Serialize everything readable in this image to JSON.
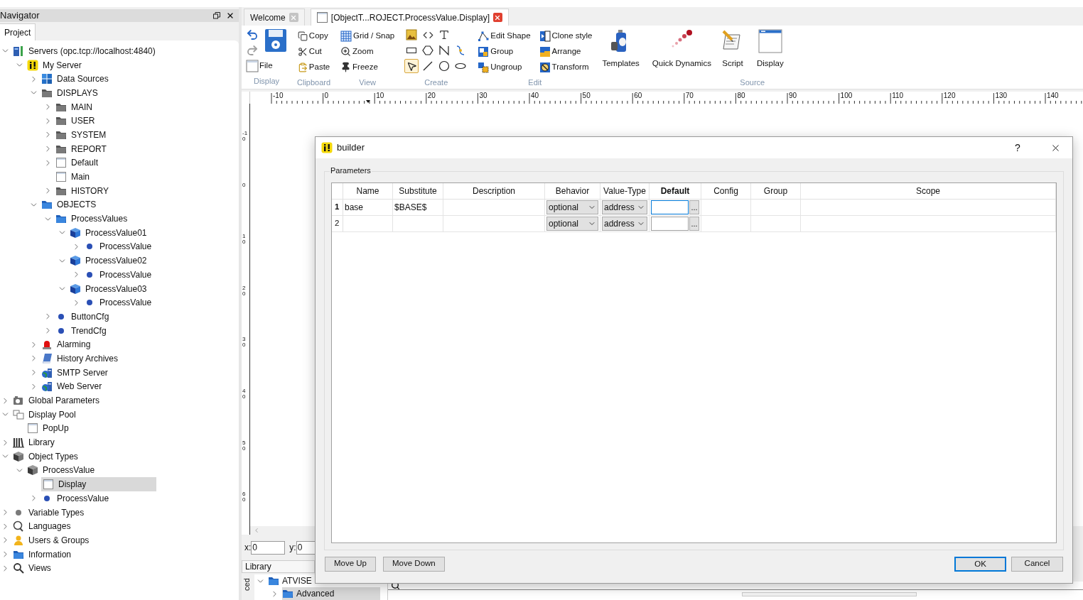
{
  "navigator": {
    "title": "Navigator",
    "tabs": [
      {
        "label": "Project",
        "selected": true
      }
    ],
    "tree": [
      {
        "label": "Servers (opc.tcp://localhost:4840)",
        "kind": "server",
        "leaf": false,
        "expanded": true,
        "selected": false,
        "children": [
          {
            "label": "My Server",
            "kind": "app",
            "leaf": false,
            "expanded": true,
            "selected": false,
            "children": [
              {
                "label": "Data Sources",
                "kind": "tiles",
                "leaf": false,
                "expanded": false,
                "selected": false
              },
              {
                "label": "DISPLAYS",
                "kind": "folder-gray",
                "leaf": false,
                "expanded": true,
                "selected": false,
                "children": [
                  {
                    "label": "MAIN",
                    "kind": "folder-gray",
                    "leaf": false,
                    "expanded": false,
                    "selected": false
                  },
                  {
                    "label": "USER",
                    "kind": "folder-gray",
                    "leaf": false,
                    "expanded": false,
                    "selected": false
                  },
                  {
                    "label": "SYSTEM",
                    "kind": "folder-gray",
                    "leaf": false,
                    "expanded": false,
                    "selected": false
                  },
                  {
                    "label": "REPORT",
                    "kind": "folder-gray",
                    "leaf": false,
                    "expanded": false,
                    "selected": false
                  },
                  {
                    "label": "Default",
                    "kind": "window",
                    "leaf": false,
                    "expanded": false,
                    "selected": false
                  },
                  {
                    "label": "Main",
                    "kind": "window",
                    "leaf": true,
                    "selected": false
                  },
                  {
                    "label": "HISTORY",
                    "kind": "folder-gray",
                    "leaf": false,
                    "expanded": false,
                    "selected": false
                  }
                ]
              },
              {
                "label": "OBJECTS",
                "kind": "folder-blue",
                "leaf": false,
                "expanded": true,
                "selected": false,
                "children": [
                  {
                    "label": "ProcessValues",
                    "kind": "folder-blue",
                    "leaf": false,
                    "expanded": true,
                    "selected": false,
                    "children": [
                      {
                        "label": "ProcessValue01",
                        "kind": "cube-blue",
                        "leaf": false,
                        "expanded": true,
                        "selected": false,
                        "children": [
                          {
                            "label": "ProcessValue",
                            "kind": "dot-blue",
                            "leaf": false,
                            "expanded": false,
                            "selected": false
                          }
                        ]
                      },
                      {
                        "label": "ProcessValue02",
                        "kind": "cube-blue",
                        "leaf": false,
                        "expanded": true,
                        "selected": false,
                        "children": [
                          {
                            "label": "ProcessValue",
                            "kind": "dot-blue",
                            "leaf": false,
                            "expanded": false,
                            "selected": false
                          }
                        ]
                      },
                      {
                        "label": "ProcessValue03",
                        "kind": "cube-blue",
                        "leaf": false,
                        "expanded": true,
                        "selected": false,
                        "children": [
                          {
                            "label": "ProcessValue",
                            "kind": "dot-blue",
                            "leaf": false,
                            "expanded": false,
                            "selected": false
                          }
                        ]
                      }
                    ]
                  },
                  {
                    "label": "ButtonCfg",
                    "kind": "dot-blue",
                    "leaf": false,
                    "expanded": false,
                    "selected": false
                  },
                  {
                    "label": "TrendCfg",
                    "kind": "dot-blue",
                    "leaf": false,
                    "expanded": false,
                    "selected": false
                  }
                ]
              },
              {
                "label": "Alarming",
                "kind": "alarm",
                "leaf": false,
                "expanded": false,
                "selected": false
              },
              {
                "label": "History Archives",
                "kind": "book",
                "leaf": false,
                "expanded": false,
                "selected": false
              },
              {
                "label": "SMTP Server",
                "kind": "smtp",
                "leaf": false,
                "expanded": false,
                "selected": false
              },
              {
                "label": "Web Server",
                "kind": "web",
                "leaf": false,
                "expanded": false,
                "selected": false
              }
            ]
          }
        ]
      },
      {
        "label": "Global Parameters",
        "kind": "camera",
        "leaf": false,
        "expanded": false,
        "selected": false
      },
      {
        "label": "Display Pool",
        "kind": "pool",
        "leaf": false,
        "expanded": true,
        "selected": false,
        "children": [
          {
            "label": "PopUp",
            "kind": "window",
            "leaf": true,
            "selected": false
          }
        ]
      },
      {
        "label": "Library",
        "kind": "library",
        "leaf": false,
        "expanded": false,
        "selected": false
      },
      {
        "label": "Object Types",
        "kind": "cube-gray",
        "leaf": false,
        "expanded": true,
        "selected": false,
        "children": [
          {
            "label": "ProcessValue",
            "kind": "cube-gray",
            "leaf": false,
            "expanded": true,
            "selected": false,
            "children": [
              {
                "label": "Display",
                "kind": "window",
                "leaf": true,
                "selected": true
              },
              {
                "label": "ProcessValue",
                "kind": "dot-blue",
                "leaf": false,
                "expanded": false,
                "selected": false
              }
            ]
          }
        ]
      },
      {
        "label": "Variable Types",
        "kind": "dot-gray",
        "leaf": false,
        "expanded": false,
        "selected": false
      },
      {
        "label": "Languages",
        "kind": "languages",
        "leaf": false,
        "expanded": false,
        "selected": false
      },
      {
        "label": "Users & Groups",
        "kind": "user",
        "leaf": false,
        "expanded": false,
        "selected": false
      },
      {
        "label": "Information",
        "kind": "folder-blue",
        "leaf": false,
        "expanded": false,
        "selected": false
      },
      {
        "label": "Views",
        "kind": "search",
        "leaf": false,
        "expanded": false,
        "selected": false
      }
    ]
  },
  "document_tabs": [
    {
      "label": "Welcome",
      "selected": false
    },
    {
      "label": "[ObjectT...ROJECT.ProcessValue.Display]",
      "selected": true
    }
  ],
  "ribbon": {
    "groups": [
      {
        "kind": "display",
        "label": "Display",
        "items": [
          {
            "kind": "undo"
          },
          {
            "kind": "redo"
          },
          {
            "kind": "save"
          },
          {
            "kind": "file",
            "label": "File"
          }
        ]
      },
      {
        "kind": "list",
        "label": "Clipboard",
        "items": [
          {
            "kind": "copy",
            "label": "Copy"
          },
          {
            "kind": "cut",
            "label": "Cut"
          },
          {
            "kind": "paste",
            "label": "Paste"
          }
        ]
      },
      {
        "kind": "list",
        "label": "View",
        "items": [
          {
            "kind": "grid",
            "label": "Grid / Snap"
          },
          {
            "kind": "zoom",
            "label": "Zoom"
          },
          {
            "kind": "freeze",
            "label": "Freeze"
          }
        ]
      },
      {
        "kind": "tools",
        "label": "Create",
        "rows": [
          [
            {
              "kind": "image",
              "selected": false
            },
            {
              "kind": "code",
              "selected": false
            },
            {
              "kind": "text",
              "selected": false
            }
          ],
          [
            {
              "kind": "rect",
              "selected": false
            },
            {
              "kind": "hexagon",
              "selected": false
            },
            {
              "kind": "polyline",
              "selected": false
            },
            {
              "kind": "connector",
              "selected": false
            }
          ],
          [
            {
              "kind": "pointer",
              "selected": true
            },
            {
              "kind": "line",
              "selected": false
            },
            {
              "kind": "circle",
              "selected": false
            },
            {
              "kind": "ellipse",
              "selected": false
            }
          ]
        ]
      },
      {
        "kind": "list",
        "label": "Edit",
        "items": [
          {
            "kind": "edit-shape",
            "label": "Edit Shape"
          },
          {
            "kind": "group",
            "label": "Group"
          },
          {
            "kind": "ungroup",
            "label": "Ungroup"
          },
          {
            "kind": "clone",
            "label": "Clone style"
          },
          {
            "kind": "arrange",
            "label": "Arrange"
          },
          {
            "kind": "transform",
            "label": "Transform"
          }
        ]
      },
      {
        "kind": "large",
        "items": [
          {
            "kind": "templates",
            "label": "Templates"
          },
          {
            "kind": "dynamics",
            "label": "Quick Dynamics"
          }
        ]
      },
      {
        "kind": "large",
        "label": "Source",
        "items": [
          {
            "kind": "script",
            "label": "Script"
          },
          {
            "kind": "display",
            "label": "Display"
          }
        ]
      }
    ]
  },
  "ruler": {
    "horizontal": [
      "-10",
      "0",
      "10",
      "20",
      "30",
      "40",
      "50",
      "60",
      "70",
      "80",
      "90",
      "100",
      "110",
      "120",
      "130",
      "140"
    ],
    "vertical": [
      "-10",
      "0",
      "10",
      "20",
      "30",
      "40",
      "50",
      "60"
    ]
  },
  "coordinates": [
    {
      "label": "x:",
      "value": "0"
    },
    {
      "label": "y:",
      "value": "0"
    }
  ],
  "library": {
    "title": "Library",
    "side_tab": "ced",
    "tree": [
      {
        "label": "ATVISE",
        "expanded": true,
        "selected": false,
        "children": [
          {
            "label": "Advanced",
            "expanded": false,
            "selected": true
          }
        ]
      }
    ]
  },
  "dialog": {
    "title": "builder",
    "help": "?",
    "group_label": "Parameters",
    "columns": [
      {
        "label": "Name",
        "selected": false
      },
      {
        "label": "Substitute",
        "selected": false
      },
      {
        "label": "Description",
        "selected": false
      },
      {
        "label": "Behavior",
        "selected": false
      },
      {
        "label": "Value-Type",
        "selected": false
      },
      {
        "label": "Default",
        "selected": true
      },
      {
        "label": "Config",
        "selected": false
      },
      {
        "label": "Group",
        "selected": false
      },
      {
        "label": "Scope",
        "selected": false
      }
    ],
    "rows": [
      {
        "number": "1",
        "selected": true,
        "name": "base",
        "substitute": "$BASE$",
        "behavior": "optional",
        "value_type": "address",
        "default_focused": true,
        "browse": "..."
      },
      {
        "number": "2",
        "selected": false,
        "behavior": "optional",
        "value_type": "address",
        "default_focused": false,
        "browse": "..."
      }
    ],
    "left_buttons": [
      {
        "label": "Move Up",
        "default": false
      },
      {
        "label": "Move Down",
        "default": false
      }
    ],
    "right_buttons": [
      {
        "label": "OK",
        "default": true
      },
      {
        "label": "Cancel",
        "default": false
      }
    ]
  }
}
